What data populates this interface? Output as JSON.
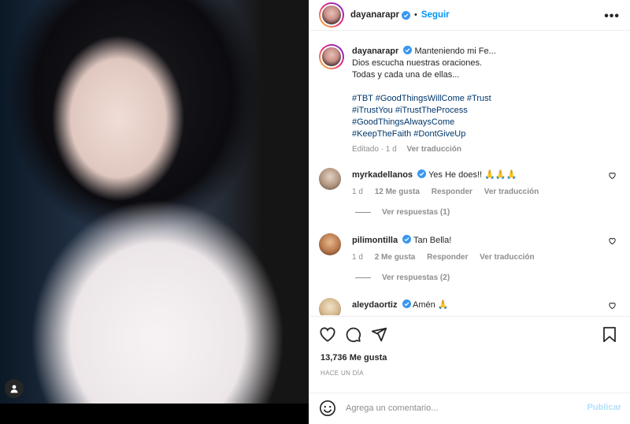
{
  "header": {
    "username": "dayanarapr",
    "separator": "•",
    "follow_label": "Seguir",
    "more_label": "•••"
  },
  "caption": {
    "username": "dayanarapr",
    "line1": "Manteniendo mi Fe...",
    "line2": "Dios escucha nuestras oraciones.",
    "line3": "Todas y cada una de ellas...",
    "hashtags": [
      "#TBT #GoodThingsWillCome #Trust",
      "#iTrustYou #iTrustTheProcess",
      "#GoodThingsAlwaysCome",
      "#KeepTheFaith #DontGiveUp"
    ],
    "edited": "Editado · 1 d",
    "see_translation": "Ver traducción"
  },
  "comments": [
    {
      "username": "myrkadellanos",
      "text": "Yes He does!! 🙏🙏🙏",
      "time": "1 d",
      "likes": "12 Me gusta",
      "reply": "Responder",
      "translate": "Ver traducción",
      "replies": "Ver respuestas (1)"
    },
    {
      "username": "pilimontilla",
      "text": "Tan Bella!",
      "time": "1 d",
      "likes": "2 Me gusta",
      "reply": "Responder",
      "translate": "Ver traducción",
      "replies": "Ver respuestas (2)"
    },
    {
      "username": "aleydaortiz",
      "text": "Amén 🙏"
    }
  ],
  "post": {
    "likes": "13,736 Me gusta",
    "time_ago": "HACE UN DÍA"
  },
  "add_comment": {
    "placeholder": "Agrega un comentario...",
    "post_label": "Publicar"
  },
  "colors": {
    "accent": "#0095f6",
    "hashtag": "#00376b",
    "muted": "#8e8e8e",
    "verified": "#3897f0"
  },
  "icons": [
    "user-tag-icon",
    "verified-icon",
    "more-icon",
    "heart-icon",
    "comment-icon",
    "share-icon",
    "bookmark-icon",
    "emoji-icon"
  ]
}
